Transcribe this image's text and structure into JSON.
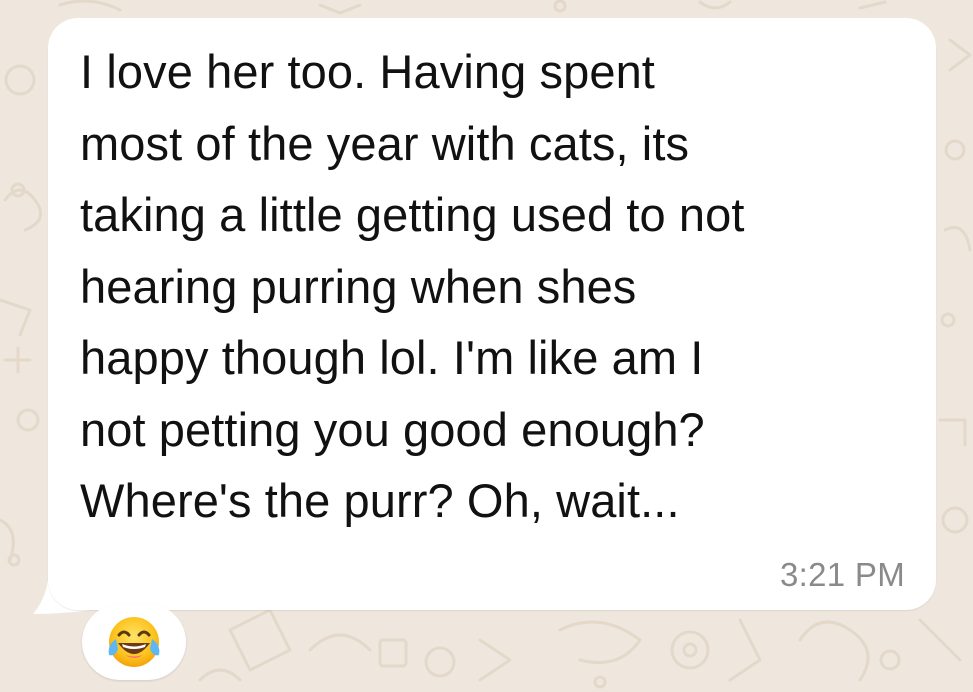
{
  "chat": {
    "background_color": "#efe7dd",
    "bubble_color": "#ffffff"
  },
  "message": {
    "text": "I love her too.  Having spent\nmost of the year with cats, its\ntaking a little getting used to not\nhearing purring when shes\nhappy though lol.  I'm like am I\nnot petting you good enough?\nWhere's the purr?  Oh, wait...",
    "timestamp": "3:21 PM"
  },
  "reaction": {
    "emoji": "face-with-tears-of-joy",
    "icon": "laughing-crying-emoji-icon"
  }
}
